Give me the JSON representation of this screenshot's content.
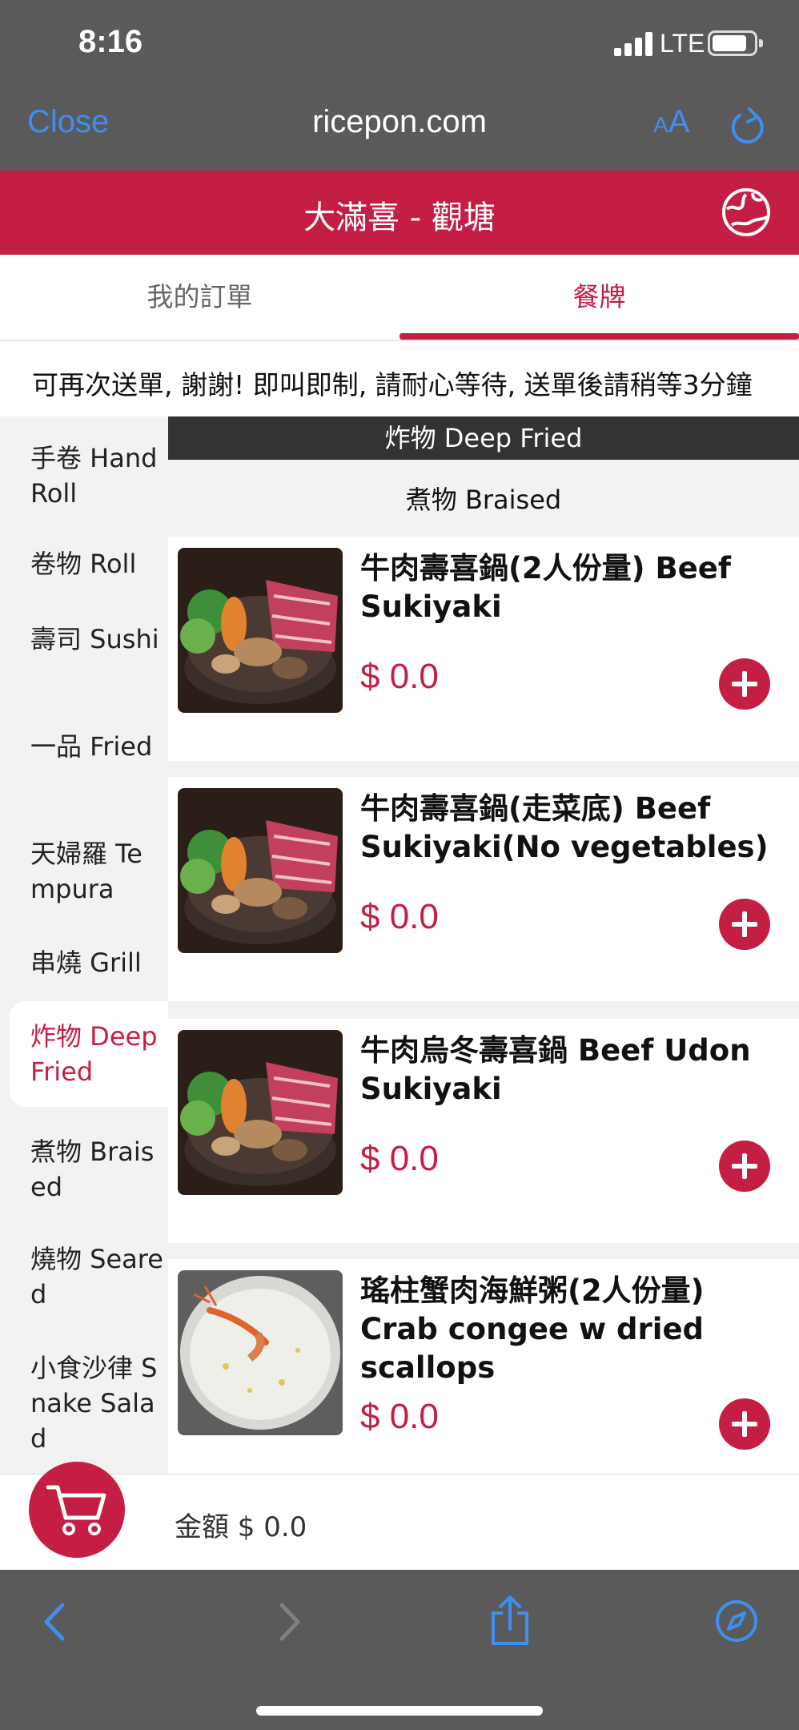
{
  "status_bar": {
    "time": "8:16",
    "network": "LTE"
  },
  "browser": {
    "close_label": "Close",
    "url": "ricepon.com",
    "text_size_label_small": "A",
    "text_size_label_large": "A"
  },
  "shop": {
    "title": "大滿喜 - 觀塘"
  },
  "tabs": [
    {
      "label": "我的訂單"
    },
    {
      "label": "餐牌"
    }
  ],
  "notice": "可再次送單, 謝謝! 即叫即制, 請耐心等待, 送單後請稍等3分鐘",
  "categories": [
    {
      "label": "手卷 Hand Roll"
    },
    {
      "label": "卷物 Roll"
    },
    {
      "label": "壽司 Sushi"
    },
    {
      "label": "一品 Fried"
    },
    {
      "label": "天婦羅 Tempura"
    },
    {
      "label": "串燒 Grill"
    },
    {
      "label": "炸物 Deep Fried"
    },
    {
      "label": "煮物 Braised"
    },
    {
      "label": "燒物 Seared"
    },
    {
      "label": "小食沙律 Snake Salad"
    }
  ],
  "sections": {
    "current": "炸物 Deep Fried",
    "next": "煮物 Braised"
  },
  "items": [
    {
      "name": "牛肉壽喜鍋(2人份量) Beef Sukiyaki",
      "price": "$ 0.0",
      "image": "sukiyaki"
    },
    {
      "name": "牛肉壽喜鍋(走菜底) Beef Sukiyaki(No vegetables)",
      "price": "$ 0.0",
      "image": "sukiyaki"
    },
    {
      "name": "牛肉烏冬壽喜鍋 Beef Udon Sukiyaki",
      "price": "$ 0.0",
      "image": "sukiyaki"
    },
    {
      "name": "瑤柱蟹肉海鮮粥(2人份量) Crab congee w dried scallops",
      "price": "$ 0.0",
      "image": "congee"
    }
  ],
  "cart": {
    "amount_label": "金額 $ 0.0"
  },
  "colors": {
    "accent": "#c41e45",
    "chrome": "#5a5a5a",
    "link": "#3d8ff0"
  }
}
